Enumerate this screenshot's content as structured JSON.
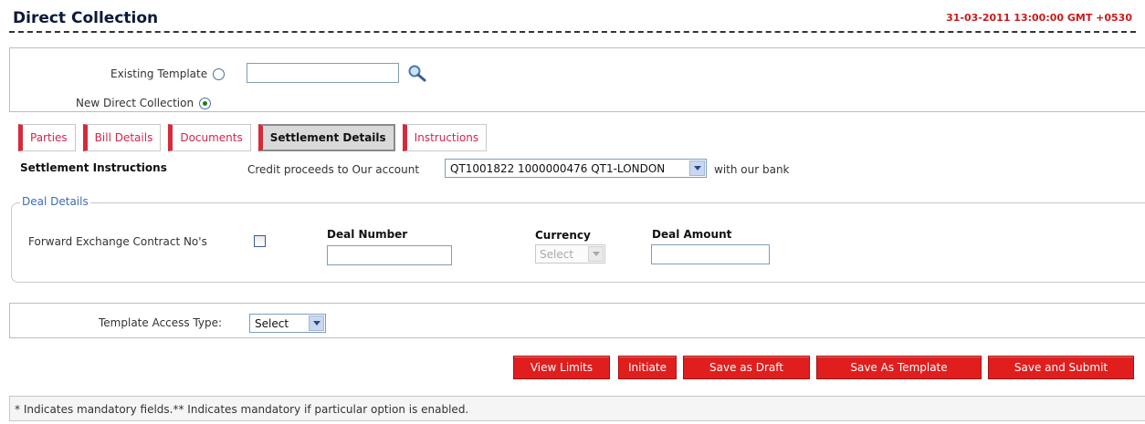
{
  "header": {
    "title": "Direct Collection",
    "timestamp": "31-03-2011 13:00:00 GMT +0530"
  },
  "template_selection": {
    "existing_template_label": "Existing Template",
    "existing_template_selected": false,
    "template_input_value": "",
    "new_collection_label": "New Direct Collection",
    "new_collection_selected": true
  },
  "tabs": [
    {
      "label": "Parties",
      "active": false
    },
    {
      "label": "Bill Details",
      "active": false
    },
    {
      "label": "Documents",
      "active": false
    },
    {
      "label": "Settlement Details",
      "active": true
    },
    {
      "label": "Instructions",
      "active": false
    }
  ],
  "settlement": {
    "section_label": "Settlement Instructions",
    "credit_label": "Credit proceeds to Our account",
    "account_value": "QT1001822 1000000476 QT1-LONDON",
    "with_bank_label": "with our bank"
  },
  "deal_details": {
    "legend": "Deal Details",
    "fwd_contract_label": "Forward Exchange Contract No's",
    "fwd_contract_checked": false,
    "deal_number_label": "Deal Number",
    "deal_number_value": "",
    "currency_label": "Currency",
    "currency_value": "Select",
    "deal_amount_label": "Deal Amount",
    "deal_amount_value": ""
  },
  "access": {
    "label": "Template Access Type:",
    "value": "Select"
  },
  "buttons": {
    "view_limits": "View Limits",
    "initiate": "Initiate",
    "save_draft": "Save as Draft",
    "save_template": "Save As Template",
    "save_submit": "Save and Submit"
  },
  "footer": {
    "note": "* Indicates mandatory fields.** Indicates mandatory if particular option is enabled."
  },
  "colors": {
    "accent_red": "#e01e1e",
    "tab_border_red": "#d62a3a",
    "timestamp_red": "#cc1a1a",
    "legend_blue": "#3b6bb5"
  }
}
